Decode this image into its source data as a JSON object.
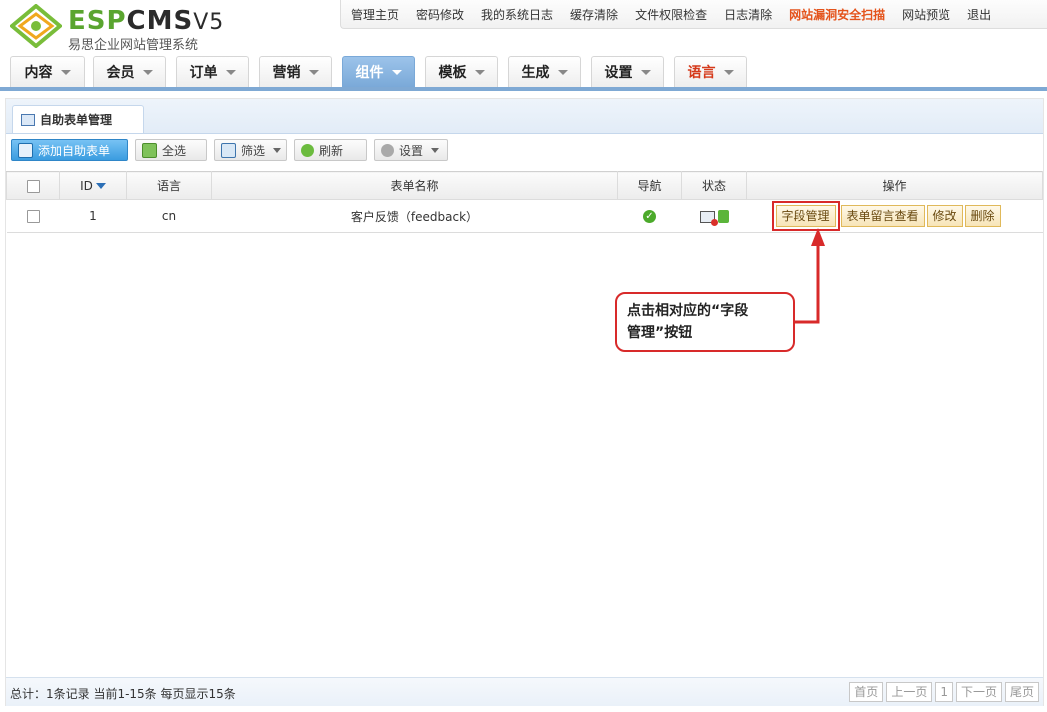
{
  "brand": {
    "esp": "ESP",
    "cms": "CMS",
    "version": "V5",
    "subtitle": "易思企业网站管理系统"
  },
  "top_links": [
    {
      "label": "管理主页"
    },
    {
      "label": "密码修改"
    },
    {
      "label": "我的系统日志"
    },
    {
      "label": "缓存清除"
    },
    {
      "label": "文件权限检查"
    },
    {
      "label": "日志清除"
    },
    {
      "label": "网站漏洞安全扫描",
      "highlight": true
    },
    {
      "label": "网站预览"
    },
    {
      "label": "退出"
    }
  ],
  "main_tabs": [
    {
      "label": "内容"
    },
    {
      "label": "会员"
    },
    {
      "label": "订单"
    },
    {
      "label": "营销"
    },
    {
      "label": "组件",
      "active": true
    },
    {
      "label": "模板"
    },
    {
      "label": "生成"
    },
    {
      "label": "设置"
    },
    {
      "label": "语言",
      "red": true
    }
  ],
  "panel": {
    "tab_title": "自助表单管理"
  },
  "toolbar": {
    "add_label": "添加自助表单",
    "select_all_label": "全选",
    "filter_label": "筛选",
    "refresh_label": "刷新",
    "settings_label": "设置"
  },
  "table": {
    "headers": {
      "id": "ID",
      "lang": "语言",
      "name": "表单名称",
      "nav": "导航",
      "status": "状态",
      "ops": "操作"
    },
    "rows": [
      {
        "id": "1",
        "lang": "cn",
        "name": "客户反馈（feedback）",
        "ops": {
          "fields": "字段管理",
          "messages": "表单留言查看",
          "edit": "修改",
          "delete": "删除"
        }
      }
    ]
  },
  "annotation": {
    "line1": "点击相对应的“字段",
    "line2": "管理”按钮",
    "color": "#d82a2a"
  },
  "footer": {
    "summary": "总计：1条记录 当前1-15条 每页显示15条",
    "pager": {
      "first": "首页",
      "prev": "上一页",
      "page": "1",
      "next": "下一页",
      "last": "尾页"
    }
  }
}
